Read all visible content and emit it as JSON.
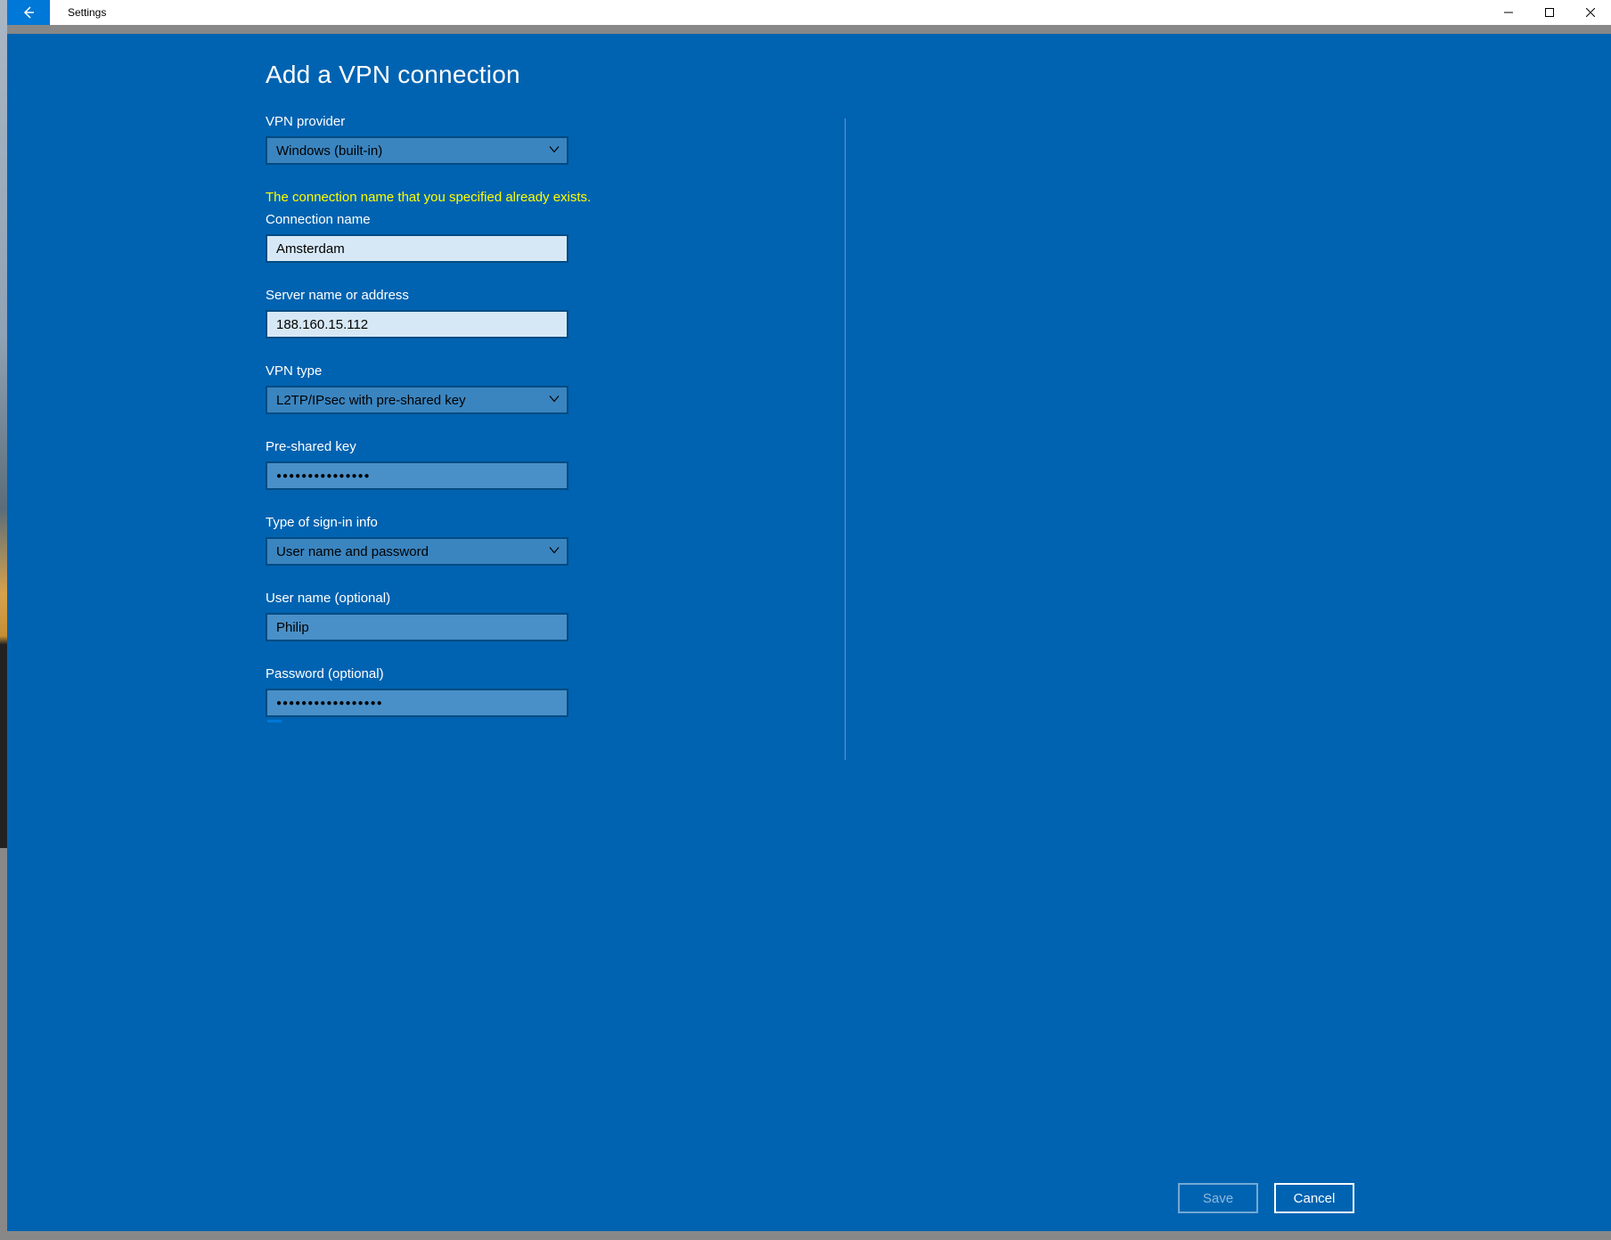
{
  "window": {
    "title": "Settings"
  },
  "page": {
    "heading": "Add a VPN connection"
  },
  "fields": {
    "vpn_provider": {
      "label": "VPN provider",
      "value": "Windows (built-in)"
    },
    "connection_name": {
      "error": "The connection name that you specified already exists.",
      "label": "Connection name",
      "value": "Amsterdam"
    },
    "server_address": {
      "label": "Server name or address",
      "value": "188.160.15.112"
    },
    "vpn_type": {
      "label": "VPN type",
      "value": "L2TP/IPsec with pre-shared key"
    },
    "psk": {
      "label": "Pre-shared key",
      "value": "●●●●●●●●●●●●●●●"
    },
    "signin_type": {
      "label": "Type of sign-in info",
      "value": "User name and password"
    },
    "username": {
      "label": "User name (optional)",
      "value": "Philip"
    },
    "password": {
      "label": "Password (optional)",
      "value": "●●●●●●●●●●●●●●●●●"
    }
  },
  "buttons": {
    "save": "Save",
    "cancel": "Cancel"
  }
}
